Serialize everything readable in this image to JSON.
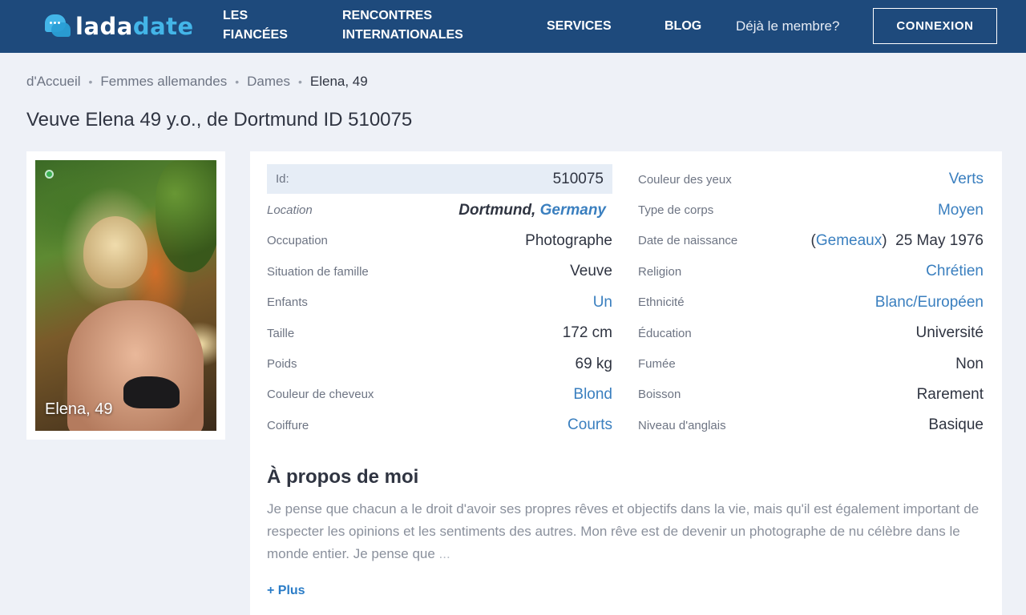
{
  "header": {
    "logo_part1": "lada",
    "logo_part2": "date",
    "nav": {
      "fiancees_line1": "LES",
      "fiancees_line2": "FIANCÉES",
      "inter_line1": "RENCONTRES",
      "inter_line2": "INTERNATIONALES",
      "services": "SERVICES",
      "blog": "BLOG"
    },
    "member_text": "Déjà le membre?",
    "login_label": "CONNEXION"
  },
  "breadcrumb": {
    "home": "d'Accueil",
    "category": "Femmes allemandes",
    "subcategory": "Dames",
    "current": "Elena, 49"
  },
  "title": "Veuve Elena 49 y.o., de Dortmund ID 510075",
  "photo": {
    "caption": "Elena, 49"
  },
  "profile": {
    "left": {
      "id_label": "Id:",
      "id_value": "510075",
      "location_label": "Location",
      "location_city": "Dortmund,",
      "location_country": "Germany",
      "occupation_label": "Occupation",
      "occupation_value": "Photographe",
      "marital_label": "Situation de famille",
      "marital_value": "Veuve",
      "children_label": "Enfants",
      "children_value": "Un",
      "height_label": "Taille",
      "height_value": "172 cm",
      "weight_label": "Poids",
      "weight_value": "69 kg",
      "hair_color_label": "Couleur de cheveux",
      "hair_color_value": "Blond",
      "hairstyle_label": "Coiffure",
      "hairstyle_value": "Courts"
    },
    "right": {
      "eyes_label": "Couleur des yeux",
      "eyes_value": "Verts",
      "body_label": "Type de corps",
      "body_value": "Moyen",
      "dob_label": "Date de naissance",
      "dob_sign": "Gemeaux",
      "dob_date": "25 May 1976",
      "religion_label": "Religion",
      "religion_value": "Chrétien",
      "ethnicity_label": "Ethnicité",
      "ethnicity_value": "Blanc/Européen",
      "education_label": "Éducation",
      "education_value": "Université",
      "smoking_label": "Fumée",
      "smoking_value": "Non",
      "drinking_label": "Boisson",
      "drinking_value": "Rarement",
      "english_label": "Niveau d'anglais",
      "english_value": "Basique"
    }
  },
  "about": {
    "title": "À propos de moi",
    "text": "Je pense que chacun a le droit d'avoir ses propres rêves et objectifs dans la vie, mais qu'il est également important de respecter les opinions et les sentiments des autres. Mon rêve est de devenir un photographe de nu célèbre dans le monde entier. Je pense que ",
    "ellipsis": "...",
    "more_label": "+ Plus"
  },
  "colors": {
    "header_bg": "#1e4a7c",
    "accent": "#3a7fbf",
    "logo_accent": "#43b5e8",
    "online": "#3bb054"
  }
}
